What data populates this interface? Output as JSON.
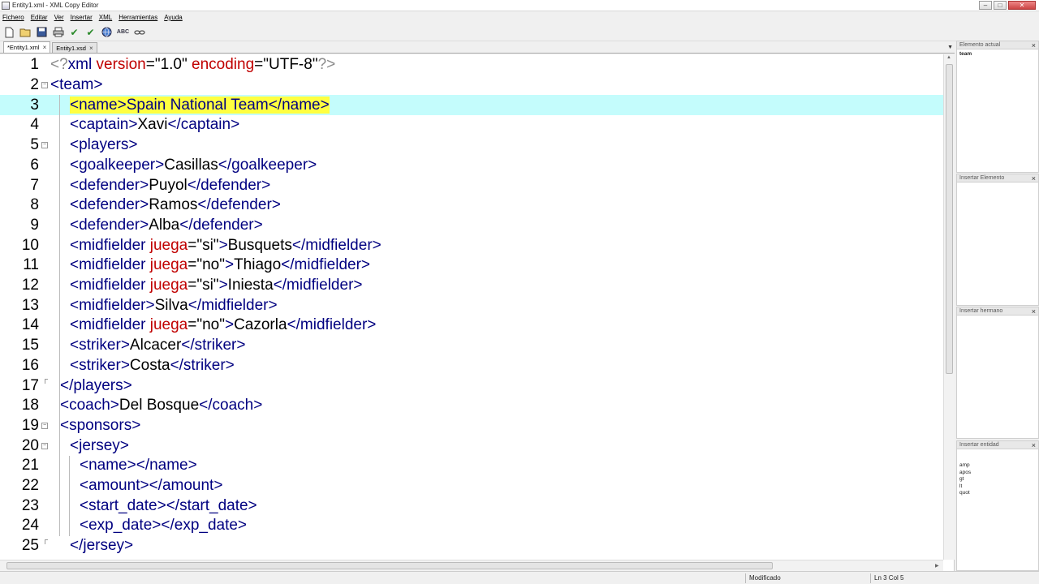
{
  "window": {
    "title": "Entity1.xml - XML Copy Editor"
  },
  "menu": [
    "Fichero",
    "Editar",
    "Ver",
    "Insertar",
    "XML",
    "Herramientas",
    "Ayuda"
  ],
  "tabs": [
    {
      "label": "*Entity1.xml",
      "active": true
    },
    {
      "label": "Entity1.xsd",
      "active": false
    }
  ],
  "editor": {
    "current_line": 3,
    "lines": [
      {
        "n": "1",
        "indent": 0,
        "fold": "",
        "code": [
          [
            "pi",
            "<?"
          ],
          [
            "t",
            "xml "
          ],
          [
            "a",
            "version"
          ],
          [
            "v",
            "=\"1.0\" "
          ],
          [
            "a",
            "encoding"
          ],
          [
            "v",
            "=\"UTF-8\""
          ],
          [
            "pi",
            "?>"
          ]
        ]
      },
      {
        "n": "2",
        "indent": 0,
        "fold": "minus",
        "code": [
          [
            "t",
            "<team>"
          ]
        ]
      },
      {
        "n": "3",
        "indent": 2,
        "fold": "",
        "code": [
          [
            "hl",
            "<name>Spain National Team</name>"
          ]
        ]
      },
      {
        "n": "4",
        "indent": 2,
        "fold": "",
        "code": [
          [
            "t",
            "<captain>"
          ],
          [
            "v",
            "Xavi"
          ],
          [
            "t",
            "</captain>"
          ]
        ]
      },
      {
        "n": "5",
        "indent": 2,
        "fold": "minus",
        "code": [
          [
            "t",
            "<players>"
          ]
        ]
      },
      {
        "n": "6",
        "indent": 2,
        "fold": "",
        "code": [
          [
            "t",
            "<goalkeeper>"
          ],
          [
            "v",
            "Casillas"
          ],
          [
            "t",
            "</goalkeeper>"
          ]
        ]
      },
      {
        "n": "7",
        "indent": 2,
        "fold": "",
        "code": [
          [
            "t",
            "<defender>"
          ],
          [
            "v",
            "Puyol"
          ],
          [
            "t",
            "</defender>"
          ]
        ]
      },
      {
        "n": "8",
        "indent": 2,
        "fold": "",
        "code": [
          [
            "t",
            "<defender>"
          ],
          [
            "v",
            "Ramos"
          ],
          [
            "t",
            "</defender>"
          ]
        ]
      },
      {
        "n": "9",
        "indent": 2,
        "fold": "",
        "code": [
          [
            "t",
            "<defender>"
          ],
          [
            "v",
            "Alba"
          ],
          [
            "t",
            "</defender>"
          ]
        ]
      },
      {
        "n": "10",
        "indent": 2,
        "fold": "",
        "code": [
          [
            "t",
            "<midfielder "
          ],
          [
            "a",
            "juega"
          ],
          [
            "v",
            "=\"si\""
          ],
          [
            "t",
            ">"
          ],
          [
            "v",
            "Busquets"
          ],
          [
            "t",
            "</midfielder>"
          ]
        ]
      },
      {
        "n": "11",
        "indent": 2,
        "fold": "",
        "code": [
          [
            "t",
            "<midfielder "
          ],
          [
            "a",
            "juega"
          ],
          [
            "v",
            "=\"no\""
          ],
          [
            "t",
            ">"
          ],
          [
            "v",
            "Thiago"
          ],
          [
            "t",
            "</midfielder>"
          ]
        ]
      },
      {
        "n": "12",
        "indent": 2,
        "fold": "",
        "code": [
          [
            "t",
            "<midfielder "
          ],
          [
            "a",
            "juega"
          ],
          [
            "v",
            "=\"si\""
          ],
          [
            "t",
            ">"
          ],
          [
            "v",
            "Iniesta"
          ],
          [
            "t",
            "</midfielder>"
          ]
        ]
      },
      {
        "n": "13",
        "indent": 2,
        "fold": "",
        "code": [
          [
            "t",
            "<midfielder>"
          ],
          [
            "v",
            "Silva"
          ],
          [
            "t",
            "</midfielder>"
          ]
        ]
      },
      {
        "n": "14",
        "indent": 2,
        "fold": "",
        "code": [
          [
            "t",
            "<midfielder "
          ],
          [
            "a",
            "juega"
          ],
          [
            "v",
            "=\"no\""
          ],
          [
            "t",
            ">"
          ],
          [
            "v",
            "Cazorla"
          ],
          [
            "t",
            "</midfielder>"
          ]
        ]
      },
      {
        "n": "15",
        "indent": 2,
        "fold": "",
        "code": [
          [
            "t",
            "<striker>"
          ],
          [
            "v",
            "Alcacer"
          ],
          [
            "t",
            "</striker>"
          ]
        ]
      },
      {
        "n": "16",
        "indent": 2,
        "fold": "",
        "code": [
          [
            "t",
            "<striker>"
          ],
          [
            "v",
            "Costa"
          ],
          [
            "t",
            "</striker>"
          ]
        ]
      },
      {
        "n": "17",
        "indent": 1,
        "fold": "end",
        "code": [
          [
            "t",
            "</players>"
          ]
        ]
      },
      {
        "n": "18",
        "indent": 1,
        "fold": "",
        "code": [
          [
            "t",
            "<coach>"
          ],
          [
            "v",
            "Del Bosque"
          ],
          [
            "t",
            "</coach>"
          ]
        ]
      },
      {
        "n": "19",
        "indent": 1,
        "fold": "minus",
        "code": [
          [
            "t",
            "<sponsors>"
          ]
        ]
      },
      {
        "n": "20",
        "indent": 2,
        "fold": "minus",
        "code": [
          [
            "t",
            "<jersey>"
          ]
        ]
      },
      {
        "n": "21",
        "indent": 3,
        "fold": "",
        "code": [
          [
            "t",
            "<name></name>"
          ]
        ]
      },
      {
        "n": "22",
        "indent": 3,
        "fold": "",
        "code": [
          [
            "t",
            "<amount></amount>"
          ]
        ]
      },
      {
        "n": "23",
        "indent": 3,
        "fold": "",
        "code": [
          [
            "t",
            "<start_date></start_date>"
          ]
        ]
      },
      {
        "n": "24",
        "indent": 3,
        "fold": "",
        "code": [
          [
            "t",
            "<exp_date></exp_date>"
          ]
        ]
      },
      {
        "n": "25",
        "indent": 2,
        "fold": "end",
        "code": [
          [
            "t",
            "</jersey>"
          ]
        ]
      }
    ]
  },
  "panels": [
    {
      "title": "Elemento actual",
      "items": [
        "team"
      ]
    },
    {
      "title": "Insertar Elemento",
      "items": []
    },
    {
      "title": "Insertar hermano",
      "items": []
    },
    {
      "title": "Insertar entidad",
      "items": [
        "amp",
        "apos",
        "gt",
        "lt",
        "quot"
      ]
    }
  ],
  "status": {
    "state": "Modificado",
    "position": "Ln 3 Col 5"
  },
  "icons": [
    "new-file-icon",
    "open-folder-icon",
    "save-icon",
    "print-icon",
    "check-wellformed-icon",
    "validate-icon",
    "globe-icon",
    "spellcheck-icon",
    "link-icon"
  ]
}
